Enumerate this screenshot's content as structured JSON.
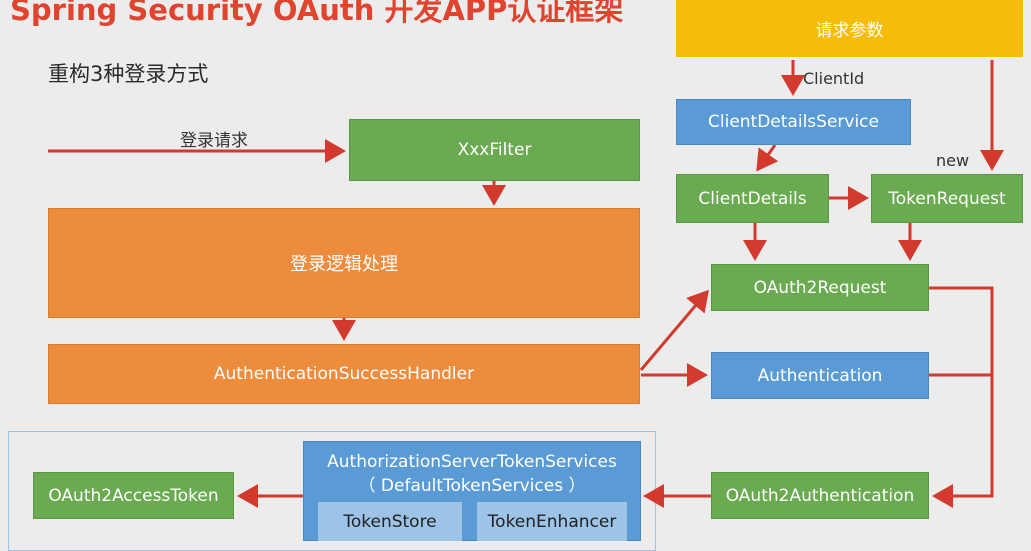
{
  "title": "Spring Security OAuth 开发APP认证框架",
  "subtitle": "重构3种登录方式",
  "nodes": {
    "request_params": "请求参数",
    "xxx_filter": "XxxFilter",
    "login_logic": "登录逻辑处理",
    "success_handler": "AuthenticationSuccessHandler",
    "client_details_service": "ClientDetailsService",
    "client_details": "ClientDetails",
    "token_request": "TokenRequest",
    "oauth2_request": "OAuth2Request",
    "authentication": "Authentication",
    "oauth2_authentication": "OAuth2Authentication",
    "token_services": "AuthorizationServerTokenServices",
    "token_services_impl": "（ DefaultTokenServices ）",
    "token_store": "TokenStore",
    "token_enhancer": "TokenEnhancer",
    "access_token": "OAuth2AccessToken"
  },
  "edge_labels": {
    "login_request": "登录请求",
    "client_id": "ClientId",
    "new": "new"
  },
  "colors": {
    "arrow": "#d23a2e",
    "green": "#6aaa50",
    "orange": "#ec8c3c",
    "blue": "#5a9bd5",
    "yellow": "#f5bd0a",
    "title": "#e0442f"
  }
}
